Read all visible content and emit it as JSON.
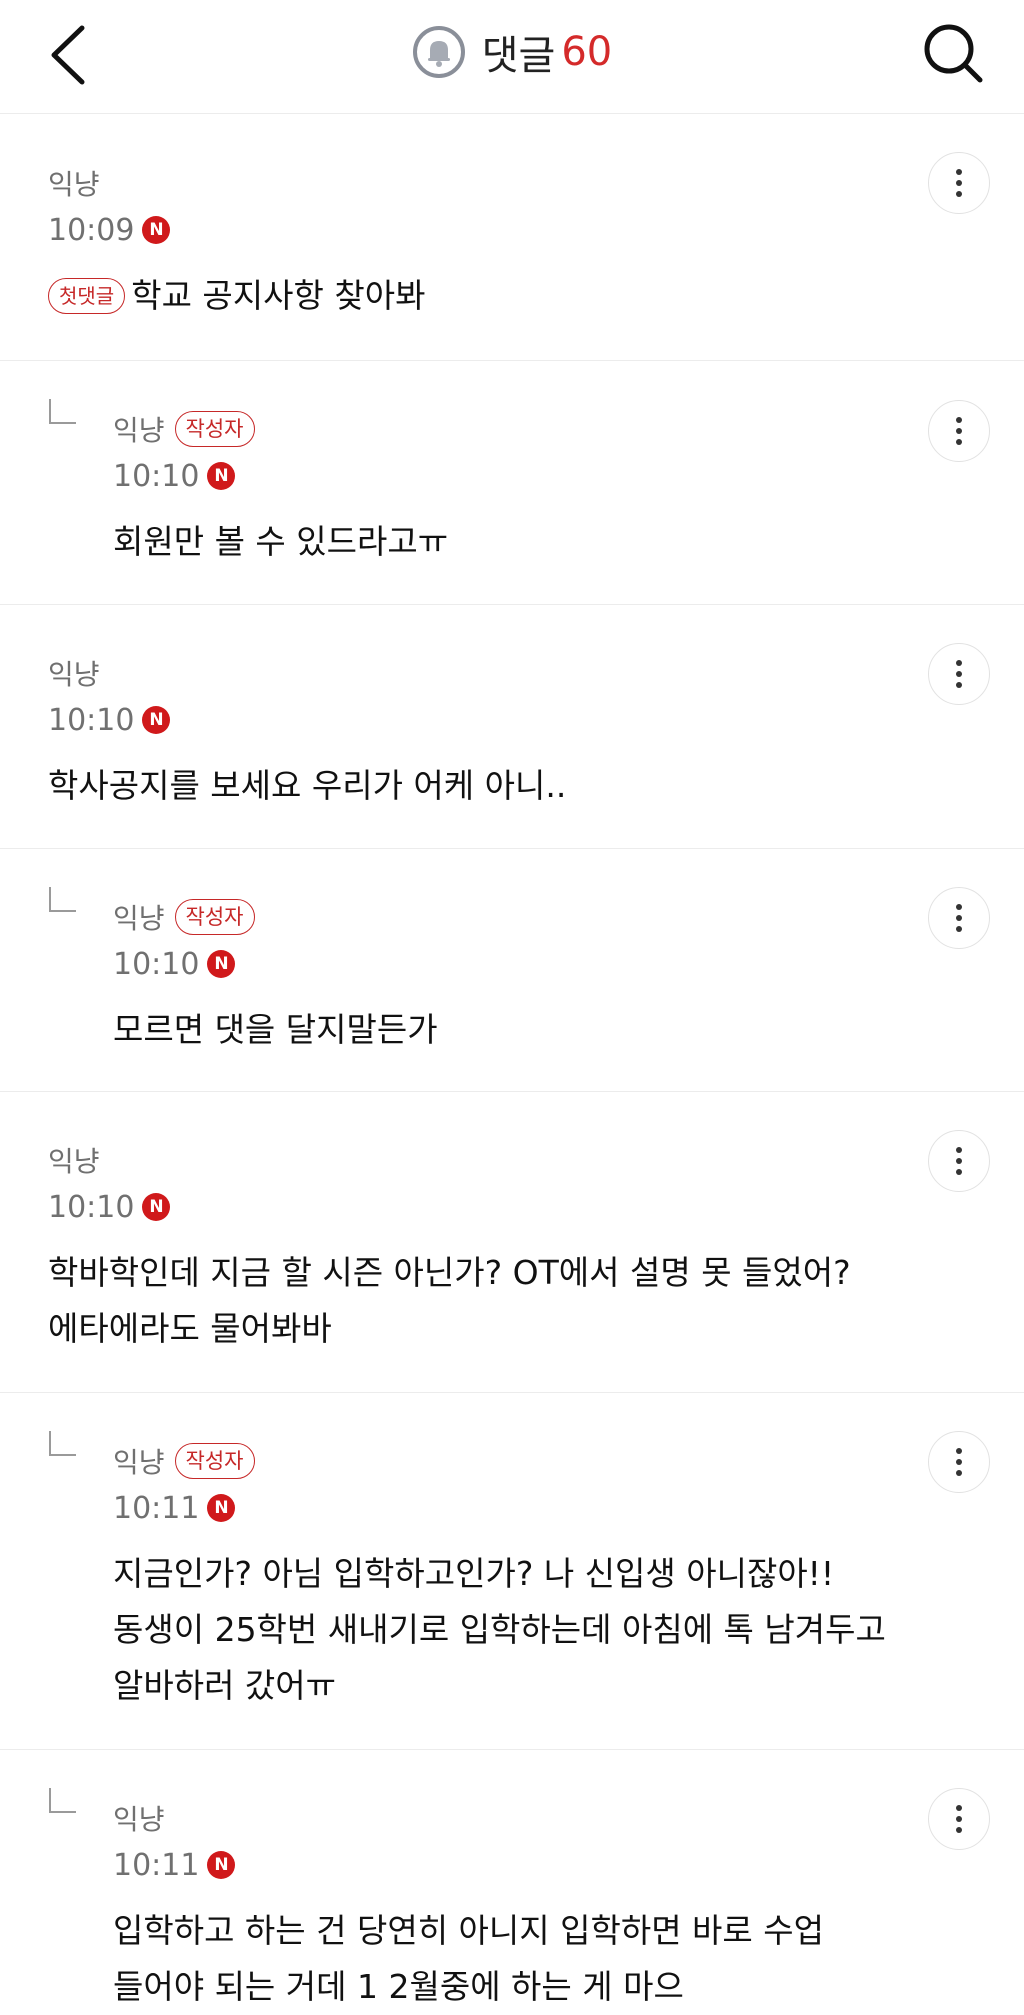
{
  "header": {
    "title": "댓글",
    "count": "60",
    "icons": {
      "back": "chevron-left-icon",
      "bell": "bell-icon",
      "search": "search-icon"
    },
    "accent_color": "#d42a2a"
  },
  "badges": {
    "writer": "작성자",
    "first": "첫댓글",
    "new": "N"
  },
  "comments": [
    {
      "author": "익냥",
      "time": "10:09",
      "is_new": true,
      "first_comment": true,
      "lines": [
        "학교 공지사항 찾아봐"
      ]
    },
    {
      "author": "익냥",
      "time": "10:10",
      "is_new": true,
      "reply": true,
      "is_writer": true,
      "lines": [
        "회원만 볼 수 있드라고ㅠ"
      ]
    },
    {
      "author": "익냥",
      "time": "10:10",
      "is_new": true,
      "lines": [
        "학사공지를 보세요 우리가 어케 아니.."
      ]
    },
    {
      "author": "익냥",
      "time": "10:10",
      "is_new": true,
      "reply": true,
      "is_writer": true,
      "lines": [
        "모르면 댓을 달지말든가"
      ]
    },
    {
      "author": "익냥",
      "time": "10:10",
      "is_new": true,
      "lines": [
        "학바학인데 지금 할 시즌 아닌가? OT에서 설명 못 들었어?",
        "에타에라도 물어봐바"
      ]
    },
    {
      "author": "익냥",
      "time": "10:11",
      "is_new": true,
      "reply": true,
      "is_writer": true,
      "lines": [
        "지금인가? 아님 입학하고인가? 나 신입생 아니잖아!!",
        "동생이 25학번 새내기로 입학하는데 아침에 톡 남겨두고",
        "알바하러 갔어ㅠ"
      ]
    },
    {
      "author": "익냥",
      "time": "10:11",
      "is_new": true,
      "reply": true,
      "lines": [
        "입학하고 하는 건 당연히 아니지 입학하면 바로 수업",
        "들어야 되는 거데 1 2월중에 하는 게 마으"
      ]
    }
  ]
}
